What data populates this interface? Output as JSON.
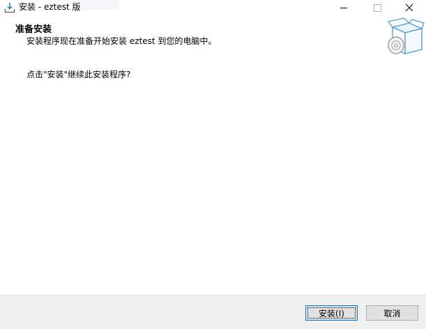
{
  "window": {
    "title": "安装 - eztest 版",
    "icon": "installer-download-icon",
    "controls": {
      "minimize_glyph": "—",
      "maximize_glyph": "☐",
      "close_glyph": "✕"
    }
  },
  "header": {
    "title": "准备安装",
    "subtitle": "安装程序现在准备开始安装 eztest 到您的电脑中。",
    "graphic_icon": "setup-box-disc-icon"
  },
  "body": {
    "message": "点击\"安装\"继续此安装程序?"
  },
  "footer": {
    "install_label": "安装(I)",
    "cancel_label": "取消"
  },
  "colors": {
    "accent": "#0078d7",
    "footer_bg": "#f0f0f0",
    "button_bg": "#e1e1e1"
  }
}
